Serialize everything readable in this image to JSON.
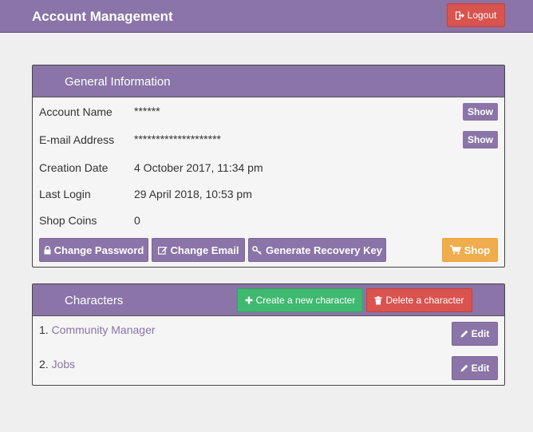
{
  "header": {
    "title": "Account Management",
    "logout_label": "Logout"
  },
  "general": {
    "title": "General Information",
    "rows": [
      {
        "label": "Account Name",
        "value": "******",
        "action": "Show"
      },
      {
        "label": "E-mail Address",
        "value": "********************",
        "action": "Show"
      },
      {
        "label": "Creation Date",
        "value": "4 October 2017, 11:34 pm"
      },
      {
        "label": "Last Login",
        "value": "29 April 2018, 10:53 pm"
      },
      {
        "label": "Shop Coins",
        "value": "0"
      }
    ],
    "buttons": {
      "change_password": "Change Password",
      "change_email": "Change Email",
      "recovery_key": "Generate Recovery Key",
      "shop": "Shop"
    }
  },
  "characters": {
    "title": "Characters",
    "create_label": "Create a new character",
    "delete_label": "Delete a character",
    "list": [
      {
        "index": "1.",
        "name": "Community Manager",
        "edit": "Edit"
      },
      {
        "index": "2.",
        "name": "Jobs",
        "edit": "Edit"
      }
    ]
  },
  "colors": {
    "accent": "#8a74a8",
    "danger": "#d9534f",
    "success": "#3fb96f",
    "warning": "#f0ad4e",
    "background": "#efefef"
  },
  "icons": {
    "logout": "sign-out-icon",
    "lock": "lock-icon",
    "email": "edit-icon",
    "key": "key-icon",
    "shop": "cart-icon",
    "create": "plus-icon",
    "delete": "trash-icon",
    "edit": "pencil-icon"
  }
}
